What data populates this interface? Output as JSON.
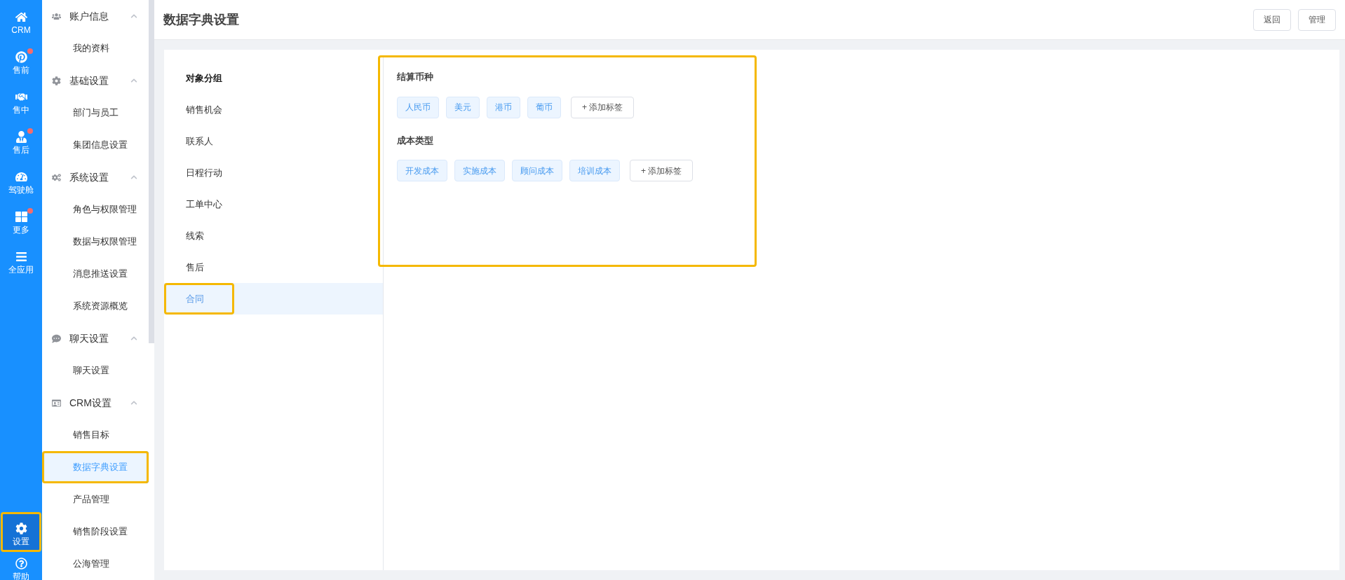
{
  "rail": [
    {
      "kind": "home",
      "label": "CRM",
      "badge": false,
      "selected": false,
      "highlighted": false
    },
    {
      "kind": "pin",
      "label": "售前",
      "badge": true,
      "selected": false,
      "highlighted": false
    },
    {
      "kind": "handshake",
      "label": "售中",
      "badge": false,
      "selected": false,
      "highlighted": false
    },
    {
      "kind": "tie",
      "label": "售后",
      "badge": true,
      "selected": false,
      "highlighted": false
    },
    {
      "kind": "gauge",
      "label": "驾驶舱",
      "badge": false,
      "selected": false,
      "highlighted": false
    },
    {
      "kind": "grid",
      "label": "更多",
      "badge": true,
      "selected": false,
      "highlighted": false
    },
    {
      "kind": "menu",
      "label": "全应用",
      "badge": false,
      "selected": false,
      "highlighted": false
    },
    {
      "kind": "gear",
      "label": "设置",
      "badge": false,
      "selected": true,
      "highlighted": true
    },
    {
      "kind": "help",
      "label": "帮助",
      "badge": false,
      "selected": false,
      "highlighted": false
    }
  ],
  "sidebar": {
    "groups": [
      {
        "kind": "users",
        "label": "账户信息",
        "expanded": true,
        "children": [
          {
            "label": "我的资料",
            "selected": false,
            "highlighted": false
          }
        ]
      },
      {
        "kind": "gear",
        "label": "基础设置",
        "expanded": true,
        "children": [
          {
            "label": "部门与员工",
            "selected": false,
            "highlighted": false
          },
          {
            "label": "集团信息设置",
            "selected": false,
            "highlighted": false
          }
        ]
      },
      {
        "kind": "gears",
        "label": "系统设置",
        "expanded": true,
        "children": [
          {
            "label": "角色与权限管理",
            "selected": false,
            "highlighted": false
          },
          {
            "label": "数据与权限管理",
            "selected": false,
            "highlighted": false
          },
          {
            "label": "消息推送设置",
            "selected": false,
            "highlighted": false
          },
          {
            "label": "系统资源概览",
            "selected": false,
            "highlighted": false
          }
        ]
      },
      {
        "kind": "chat",
        "label": "聊天设置",
        "expanded": true,
        "children": [
          {
            "label": "聊天设置",
            "selected": false,
            "highlighted": false
          }
        ]
      },
      {
        "kind": "card",
        "label": "CRM设置",
        "expanded": true,
        "children": [
          {
            "label": "销售目标",
            "selected": false,
            "highlighted": false
          },
          {
            "label": "数据字典设置",
            "selected": true,
            "highlighted": true
          },
          {
            "label": "产品管理",
            "selected": false,
            "highlighted": false
          },
          {
            "label": "销售阶段设置",
            "selected": false,
            "highlighted": false
          },
          {
            "label": "公海管理",
            "selected": false,
            "highlighted": false
          }
        ]
      }
    ]
  },
  "header": {
    "title": "数据字典设置",
    "buttons": [
      "返回",
      "管理"
    ]
  },
  "object_groups": {
    "heading": "对象分组",
    "items": [
      {
        "label": "销售机会",
        "selected": false,
        "highlighted": false
      },
      {
        "label": "联系人",
        "selected": false,
        "highlighted": false
      },
      {
        "label": "日程行动",
        "selected": false,
        "highlighted": false
      },
      {
        "label": "工单中心",
        "selected": false,
        "highlighted": false
      },
      {
        "label": "线索",
        "selected": false,
        "highlighted": false
      },
      {
        "label": "售后",
        "selected": false,
        "highlighted": false
      },
      {
        "label": "合同",
        "selected": true,
        "highlighted": true
      }
    ]
  },
  "dictionary": {
    "highlighted": true,
    "sections": [
      {
        "title": "结算币种",
        "tags": [
          "人民币",
          "美元",
          "港币",
          "葡币"
        ],
        "add_label": "+ 添加标签"
      },
      {
        "title": "成本类型",
        "tags": [
          "开发成本",
          "实施成本",
          "顾问成本",
          "培训成本"
        ],
        "add_label": "+ 添加标签"
      }
    ]
  }
}
